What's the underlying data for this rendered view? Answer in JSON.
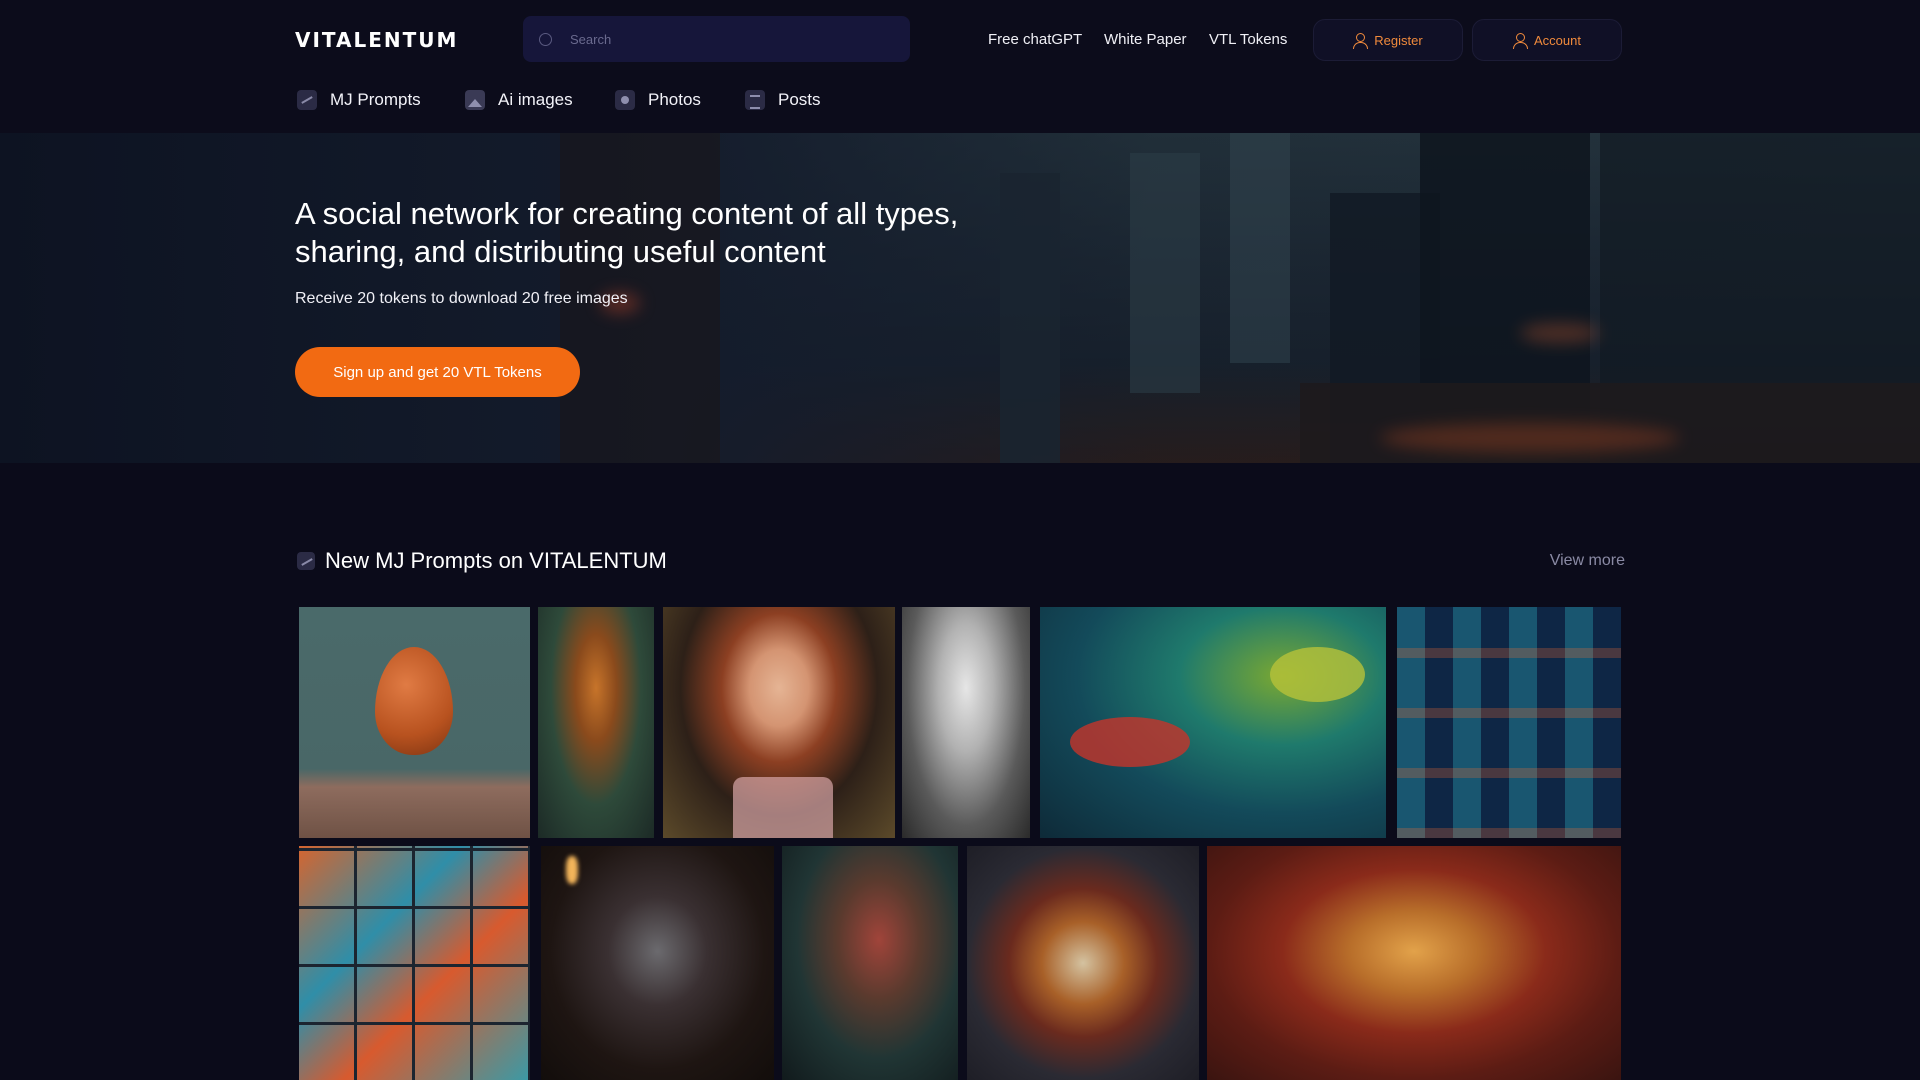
{
  "header": {
    "logo": "VITALENTUM",
    "search": {
      "placeholder": "Search"
    },
    "links": [
      "Free chatGPT",
      "White Paper",
      "VTL Tokens"
    ],
    "register_label": "Register",
    "account_label": "Account"
  },
  "categories": [
    {
      "label": "MJ Prompts",
      "icon": "trend-icon"
    },
    {
      "label": "Ai images",
      "icon": "image-icon"
    },
    {
      "label": "Photos",
      "icon": "photo-icon"
    },
    {
      "label": "Posts",
      "icon": "posts-icon"
    }
  ],
  "hero": {
    "title": "A social network for creating content of all types, sharing, and distributing useful content",
    "subtitle": "Receive 20 tokens to download 20 free images",
    "cta_label": "Sign up and get 20 VTL Tokens"
  },
  "section": {
    "title": "New MJ Prompts on VITALENTUM",
    "view_more": "View more"
  },
  "gallery": [
    {
      "subject": "egg on table"
    },
    {
      "subject": "tiger in foliage"
    },
    {
      "subject": "smiling red-haired woman"
    },
    {
      "subject": "black and white woman portrait"
    },
    {
      "subject": "underwater fish"
    },
    {
      "subject": "patterned cats blue"
    },
    {
      "subject": "patterned cats grid"
    },
    {
      "subject": "raccoon at piano"
    },
    {
      "subject": "chameleon"
    },
    {
      "subject": "ornate lion mask"
    },
    {
      "subject": "lion portrait"
    }
  ],
  "colors": {
    "background": "#0b0b1a",
    "accent": "#f26a12",
    "accent_text": "#f08a3c"
  }
}
